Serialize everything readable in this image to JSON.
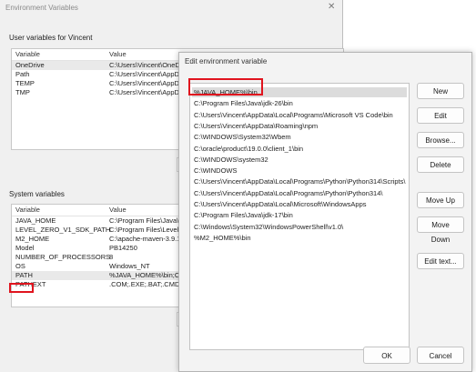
{
  "main_window": {
    "title": "Environment Variables",
    "close_glyph": "✕",
    "user_section_label": "User variables for Vincent",
    "system_section_label": "System variables",
    "columns": {
      "variable": "Variable",
      "value": "Value"
    },
    "user_vars": [
      {
        "name": "OneDrive",
        "value": "C:\\Users\\Vincent\\OneD"
      },
      {
        "name": "Path",
        "value": "C:\\Users\\Vincent\\AppD"
      },
      {
        "name": "TEMP",
        "value": "C:\\Users\\Vincent\\AppD"
      },
      {
        "name": "TMP",
        "value": "C:\\Users\\Vincent\\AppD"
      }
    ],
    "system_vars": [
      {
        "name": "JAVA_HOME",
        "value": "C:\\Program Files\\Java\\j"
      },
      {
        "name": "LEVEL_ZERO_V1_SDK_PATH",
        "value": "C:\\Program Files\\Level2"
      },
      {
        "name": "M2_HOME",
        "value": "C:\\apache-maven-3.9.1"
      },
      {
        "name": "Model",
        "value": "PB14250"
      },
      {
        "name": "NUMBER_OF_PROCESSORS",
        "value": "8"
      },
      {
        "name": "OS",
        "value": "Windows_NT"
      },
      {
        "name": "PATH",
        "value": "%JAVA_HOME%\\bin;C:\\"
      },
      {
        "name": "PATHEXT",
        "value": ".COM;.EXE;.BAT;.CMD;.V"
      }
    ]
  },
  "dialog": {
    "title": "Edit environment variable",
    "entries": [
      "%JAVA_HOME%\\bin",
      "C:\\Program Files\\Java\\jdk-26\\bin",
      "C:\\Users\\Vincent\\AppData\\Local\\Programs\\Microsoft VS Code\\bin",
      "C:\\Users\\Vincent\\AppData\\Roaming\\npm",
      "C:\\WINDOWS\\System32\\Wbem",
      "C:\\oracle\\product\\19.0.0\\client_1\\bin",
      "C:\\WINDOWS\\system32",
      "C:\\WINDOWS",
      "C:\\Users\\Vincent\\AppData\\Local\\Programs\\Python\\Python314\\Scripts\\",
      "C:\\Users\\Vincent\\AppData\\Local\\Programs\\Python\\Python314\\",
      "C:\\Users\\Vincent\\AppData\\Local\\Microsoft\\WindowsApps",
      "C:\\Program Files\\Java\\jdk-17\\bin",
      "C:\\Windows\\System32\\WindowsPowerShell\\v1.0\\",
      "%M2_HOME%\\bin"
    ],
    "buttons": {
      "new": "New",
      "edit": "Edit",
      "browse": "Browse...",
      "delete": "Delete",
      "move_up": "Move Up",
      "move_down": "Move Down",
      "edit_text": "Edit text...",
      "ok": "OK",
      "cancel": "Cancel"
    }
  },
  "colors": {
    "highlight_box": "#e0141e",
    "selected_row": "#dcdcdc"
  }
}
